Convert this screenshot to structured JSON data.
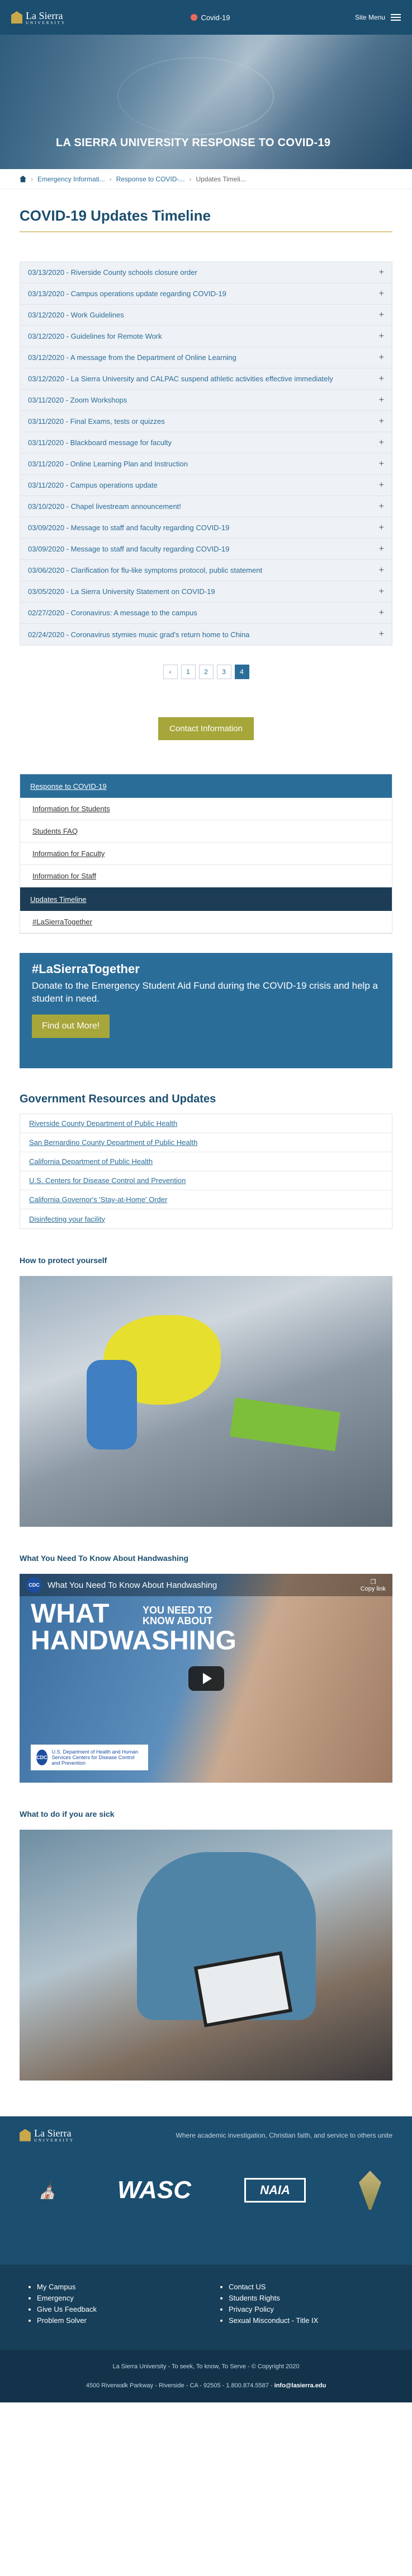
{
  "header": {
    "logo_text": "La Sierra",
    "logo_sub": "UNIVERSITY",
    "alert_label": "Covid-19",
    "menu_label": "Site Menu"
  },
  "hero": {
    "title": "LA SIERRA UNIVERSITY RESPONSE TO COVID-19"
  },
  "breadcrumbs": [
    "Emergency Informati...",
    "Response to COVID-...",
    "Updates Timeli..."
  ],
  "page_title": "COVID-19 Updates Timeline",
  "timeline": [
    "03/13/2020 - Riverside County schools closure order",
    "03/13/2020 - Campus operations update regarding COVID-19",
    "03/12/2020 - Work Guidelines",
    "03/12/2020 - Guidelines for Remote Work",
    "03/12/2020 - A message from the Department of Online Learning",
    "03/12/2020 - La Sierra University and CALPAC suspend athletic activities effective immediately",
    "03/11/2020 - Zoom Workshops",
    "03/11/2020 - Final Exams, tests or quizzes",
    "03/11/2020 - Blackboard message for faculty",
    "03/11/2020 - Online Learning Plan and Instruction",
    "03/11/2020 - Campus operations update",
    "03/10/2020 - Chapel livestream announcement!",
    "03/09/2020 - Message to staff and faculty regarding COVID-19",
    "03/09/2020 - Message to staff and faculty regarding COVID-19",
    "03/06/2020 - Clarification for flu-like symptoms protocol, public statement",
    "03/05/2020 - La Sierra University Statement on COVID-19",
    "02/27/2020 - Coronavirus: A message to the campus",
    "02/24/2020 - Coronavirus stymies music grad's return home to China"
  ],
  "pagination": {
    "prev": "‹",
    "pages": [
      "1",
      "2",
      "3",
      "4"
    ],
    "active": "4"
  },
  "contact_button": "Contact Information",
  "sidenav": {
    "head": "Response to COVID-19",
    "items": [
      "Information for Students",
      "Students FAQ",
      "Information for Faculty",
      "Information for Staff"
    ],
    "active": "Updates Timeline",
    "tag": "#LaSierraTogether"
  },
  "promo": {
    "title": "#LaSierraTogether",
    "text": "Donate to the Emergency Student Aid Fund during the COVID-19 crisis and help a student in need.",
    "button": "Find out More!"
  },
  "resources": {
    "title": "Government Resources and Updates",
    "items": [
      "Riverside County Department of Public Health",
      "San Bernardino County Department of Public Health",
      "California Department of Public Health",
      "U.S. Centers for Disease Control and Prevention",
      "California Governor's 'Stay-at-Home' Order",
      "Disinfecting your facility"
    ]
  },
  "sections": {
    "protect": "How to protect yourself",
    "handwashing": "What You Need To Know About Handwashing",
    "sick": "What to do if you are sick"
  },
  "video": {
    "channel": "CDC",
    "title": "What You Need To Know About Handwashing",
    "copy_label": "Copy link",
    "big_word_1": "WHAT",
    "small_words": "YOU NEED TO KNOW ABOUT",
    "big_word_2": "HANDWASHING",
    "badge_text": "U.S. Department of Health and Human Services Centers for Disease Control and Prevention"
  },
  "footer": {
    "tagline": "Where academic investigation, Christian faith, and service to others unite",
    "badges": [
      "SDA",
      "WASC",
      "NAIA",
      "Ribbon"
    ],
    "links_left": [
      "My Campus",
      "Emergency",
      "Give Us Feedback",
      "Problem Solver"
    ],
    "links_right": [
      "Contact US",
      "Students Rights",
      "Privacy Policy",
      "Sexual Misconduct - Title IX"
    ],
    "motto": "La Sierra University - To seek, To know, To Serve - © Copyright 2020",
    "address": "4500 Riverwalk Parkway - Riverside - CA - 92505 - 1.800.874.5587 - ",
    "email": "info@lasierra.edu"
  }
}
